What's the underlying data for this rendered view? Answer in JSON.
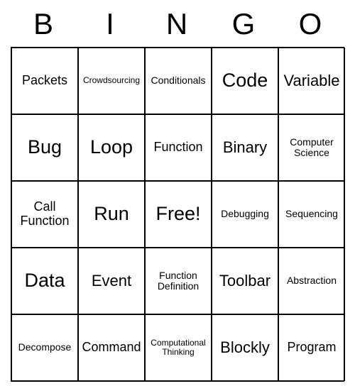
{
  "header": {
    "letters": [
      "B",
      "I",
      "N",
      "G",
      "O"
    ]
  },
  "grid": {
    "cells": [
      {
        "text": "Packets",
        "size": "fs-md"
      },
      {
        "text": "Crowdsourcing",
        "size": "fs-xs"
      },
      {
        "text": "Conditionals",
        "size": "fs-sm"
      },
      {
        "text": "Code",
        "size": "fs-xl"
      },
      {
        "text": "Variable",
        "size": "fs-lg"
      },
      {
        "text": "Bug",
        "size": "fs-xl"
      },
      {
        "text": "Loop",
        "size": "fs-xl"
      },
      {
        "text": "Function",
        "size": "fs-md"
      },
      {
        "text": "Binary",
        "size": "fs-lg"
      },
      {
        "text": "Computer Science",
        "size": "fs-sm"
      },
      {
        "text": "Call Function",
        "size": "fs-md"
      },
      {
        "text": "Run",
        "size": "fs-xl"
      },
      {
        "text": "Free!",
        "size": "fs-xl"
      },
      {
        "text": "Debugging",
        "size": "fs-sm"
      },
      {
        "text": "Sequencing",
        "size": "fs-sm"
      },
      {
        "text": "Data",
        "size": "fs-xl"
      },
      {
        "text": "Event",
        "size": "fs-lg"
      },
      {
        "text": "Function Definition",
        "size": "fs-sm"
      },
      {
        "text": "Toolbar",
        "size": "fs-lg"
      },
      {
        "text": "Abstraction",
        "size": "fs-sm"
      },
      {
        "text": "Decompose",
        "size": "fs-sm"
      },
      {
        "text": "Command",
        "size": "fs-md"
      },
      {
        "text": "Computational Thinking",
        "size": "fs-xs"
      },
      {
        "text": "Blockly",
        "size": "fs-lg"
      },
      {
        "text": "Program",
        "size": "fs-md"
      }
    ]
  }
}
